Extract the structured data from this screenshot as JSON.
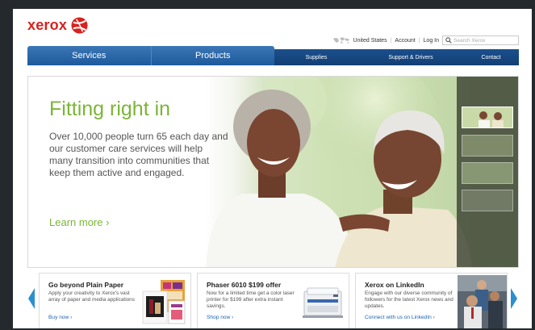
{
  "header": {
    "logo_text": "xerox",
    "country": "United States",
    "account": "Account",
    "login": "Log In",
    "search_placeholder": "Search Xerox"
  },
  "nav": {
    "main": [
      "Services",
      "Products"
    ],
    "sub": [
      "Supplies",
      "Support & Drivers",
      "Contact"
    ]
  },
  "hero": {
    "title": "Fitting right in",
    "body": "Over 10,000 people turn 65 each day and our customer care services will help many transition into communities that keep them active and engaged.",
    "cta": "Learn more ›"
  },
  "promos": [
    {
      "title": "Go beyond Plain Paper",
      "desc": "Apply your creativity to Xerox's vast array of paper and media applications",
      "link": "Buy now ›"
    },
    {
      "title": "Phaser 6010 $199 offer",
      "desc": "Now for a limited time get a color laser printer for $199 after extra instant savings.",
      "link": "Shop now ›"
    },
    {
      "title": "Xerox on LinkedIn",
      "desc": "Engage with our diverse community of followers for the latest Xerox news and updates.",
      "link": "Connect with us on LinkedIn ›"
    }
  ],
  "colors": {
    "brand_red": "#d7231f",
    "nav_blue": "#1d5a9b",
    "accent_green": "#7bb537",
    "link_blue": "#1d63b0"
  }
}
